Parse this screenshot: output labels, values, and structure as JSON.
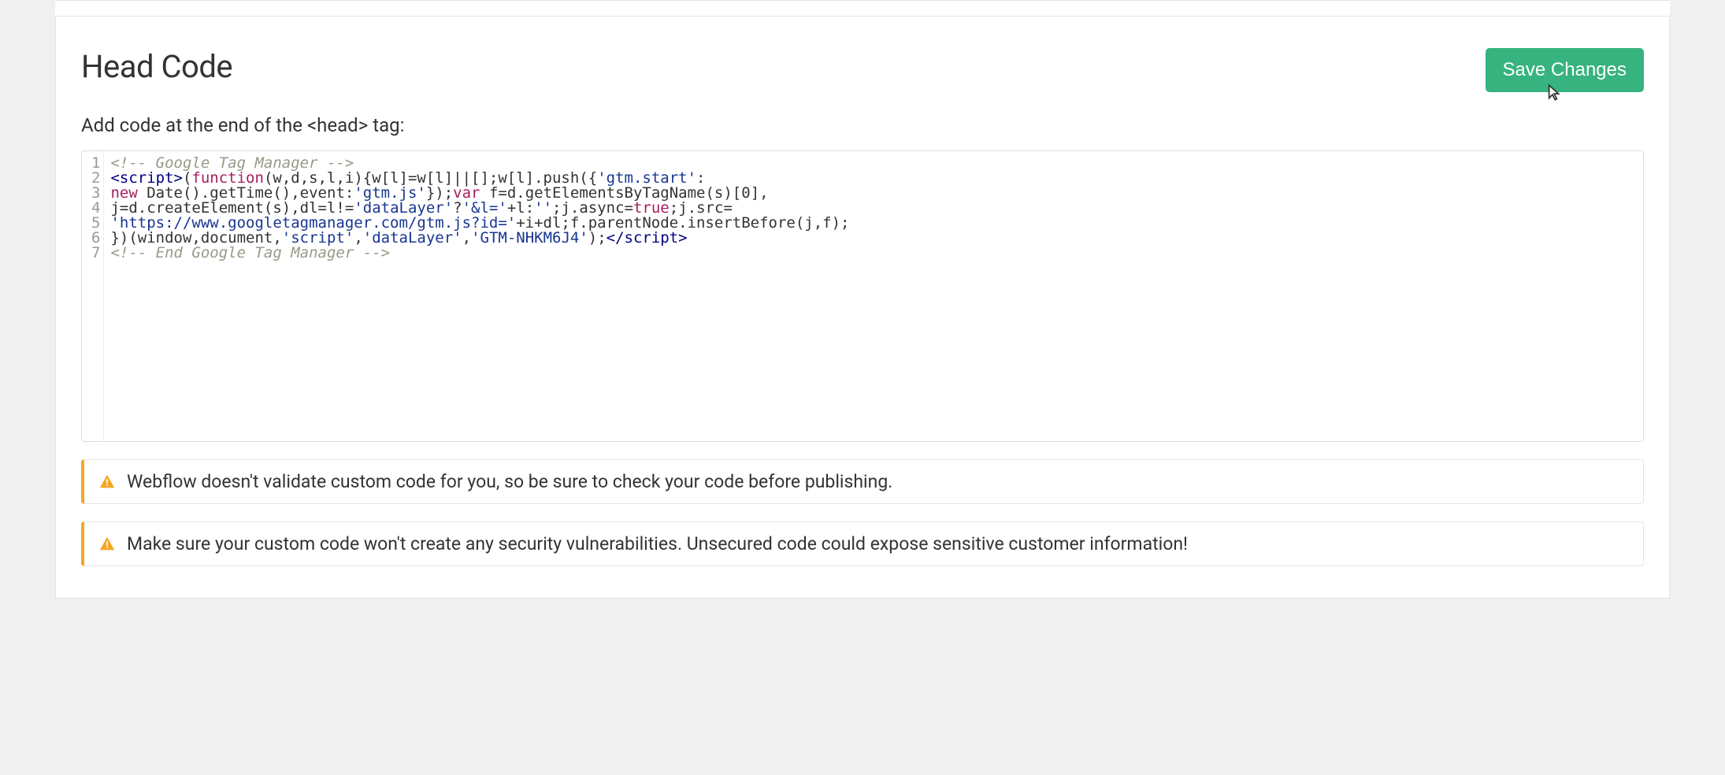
{
  "heading": "Head Code",
  "saveButtonLabel": "Save Changes",
  "labelPrefix": "Add code at the end of the ",
  "labelTag": "<head>",
  "labelSuffix": " tag:",
  "code": {
    "lineNumbers": [
      "1",
      "2",
      "3",
      "4",
      "5",
      "6",
      "7"
    ],
    "lines": [
      [
        {
          "cls": "tok-comment",
          "t": "<!-- Google Tag Manager -->"
        }
      ],
      [
        {
          "cls": "tok-tag",
          "t": "<script>"
        },
        {
          "cls": "tok-default",
          "t": "("
        },
        {
          "cls": "tok-keyword",
          "t": "function"
        },
        {
          "cls": "tok-default",
          "t": "(w,d,s,l,i){w[l]=w[l]||[];w[l].push({"
        },
        {
          "cls": "tok-string",
          "t": "'gtm.start'"
        },
        {
          "cls": "tok-default",
          "t": ":"
        }
      ],
      [
        {
          "cls": "tok-keyword",
          "t": "new"
        },
        {
          "cls": "tok-default",
          "t": " Date().getTime(),event:"
        },
        {
          "cls": "tok-string",
          "t": "'gtm.js'"
        },
        {
          "cls": "tok-default",
          "t": "});"
        },
        {
          "cls": "tok-keyword",
          "t": "var"
        },
        {
          "cls": "tok-default",
          "t": " f=d.getElementsByTagName(s)["
        },
        {
          "cls": "tok-default",
          "t": "0"
        },
        {
          "cls": "tok-default",
          "t": "],"
        }
      ],
      [
        {
          "cls": "tok-default",
          "t": "j=d.createElement(s),dl=l!="
        },
        {
          "cls": "tok-string",
          "t": "'dataLayer'"
        },
        {
          "cls": "tok-default",
          "t": "?"
        },
        {
          "cls": "tok-string",
          "t": "'&l='"
        },
        {
          "cls": "tok-default",
          "t": "+l:"
        },
        {
          "cls": "tok-string",
          "t": "''"
        },
        {
          "cls": "tok-default",
          "t": ";j.async="
        },
        {
          "cls": "tok-keyword",
          "t": "true"
        },
        {
          "cls": "tok-default",
          "t": ";j.src="
        }
      ],
      [
        {
          "cls": "tok-string",
          "t": "'https://www.googletagmanager.com/gtm.js?id='"
        },
        {
          "cls": "tok-default",
          "t": "+i+dl;f.parentNode.insertBefore(j,f);"
        }
      ],
      [
        {
          "cls": "tok-default",
          "t": "})(window,document,"
        },
        {
          "cls": "tok-string",
          "t": "'script'"
        },
        {
          "cls": "tok-default",
          "t": ","
        },
        {
          "cls": "tok-string",
          "t": "'dataLayer'"
        },
        {
          "cls": "tok-default",
          "t": ","
        },
        {
          "cls": "tok-string",
          "t": "'GTM-NHKM6J4'"
        },
        {
          "cls": "tok-default",
          "t": ");"
        },
        {
          "cls": "tok-tag",
          "t": "</script>"
        }
      ],
      [
        {
          "cls": "tok-comment",
          "t": "<!-- End Google Tag Manager -->"
        }
      ]
    ]
  },
  "alerts": [
    "Webflow doesn't validate custom code for you, so be sure to check your code before publishing.",
    "Make sure your custom code won't create any security vulnerabilities. Unsecured code could expose sensitive customer information!"
  ],
  "colors": {
    "saveBg": "#36b37e",
    "alertBorder": "#f5a623"
  }
}
